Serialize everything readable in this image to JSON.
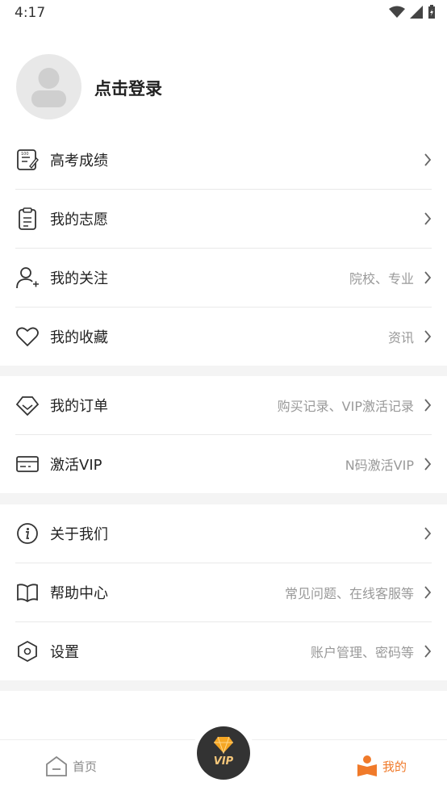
{
  "status_bar": {
    "time": "4:17"
  },
  "profile": {
    "login_text": "点击登录"
  },
  "section1": [
    {
      "label": "高考成绩",
      "sub": "",
      "icon": "score-icon"
    },
    {
      "label": "我的志愿",
      "sub": "",
      "icon": "clipboard-icon"
    },
    {
      "label": "我的关注",
      "sub": "院校、专业",
      "icon": "user-add-icon"
    },
    {
      "label": "我的收藏",
      "sub": "资讯",
      "icon": "heart-icon"
    }
  ],
  "section2": [
    {
      "label": "我的订单",
      "sub": "购买记录、VIP激活记录",
      "icon": "diamond-icon"
    },
    {
      "label": "激活VIP",
      "sub": "N码激活VIP",
      "icon": "card-icon"
    }
  ],
  "section3": [
    {
      "label": "关于我们",
      "sub": "",
      "icon": "info-icon"
    },
    {
      "label": "帮助中心",
      "sub": "常见问题、在线客服等",
      "icon": "book-icon"
    },
    {
      "label": "设置",
      "sub": "账户管理、密码等",
      "icon": "hexagon-icon"
    }
  ],
  "tabbar": {
    "home_label": "首页",
    "vip_label": "VIP",
    "mine_label": "我的",
    "active_color": "#f07a2a"
  }
}
